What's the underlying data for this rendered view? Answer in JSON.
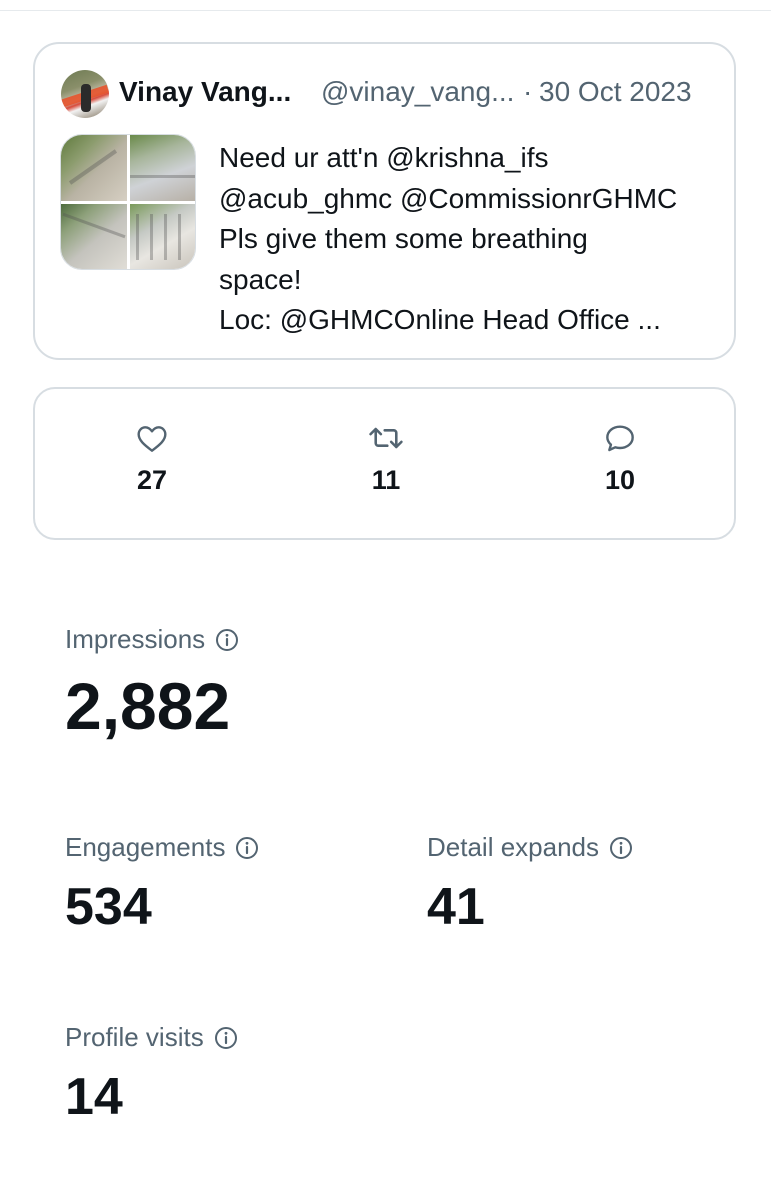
{
  "tweet": {
    "author_name": "Vinay Vang...",
    "handle": "@vinay_vang...",
    "separator": "·",
    "date": "30 Oct 2023",
    "text_lines": [
      "Need ur att'n @krishna_ifs",
      "@acub_ghmc @CommissionrGHMC",
      "Pls give them some breathing",
      "space!",
      "Loc: @GHMCOnline Head Office ..."
    ],
    "media_count": 4
  },
  "actions": {
    "likes": "27",
    "reposts": "11",
    "replies": "10"
  },
  "metrics": {
    "impressions": {
      "label": "Impressions",
      "value": "2,882"
    },
    "engagements": {
      "label": "Engagements",
      "value": "534"
    },
    "detail_expands": {
      "label": "Detail expands",
      "value": "41"
    },
    "profile_visits": {
      "label": "Profile visits",
      "value": "14"
    }
  },
  "colors": {
    "text_primary": "#0f1419",
    "text_secondary": "#536471",
    "border": "#d7dde2"
  },
  "icons": {
    "like": "heart-icon",
    "repost": "repost-icon",
    "reply": "reply-icon",
    "info": "info-icon"
  }
}
